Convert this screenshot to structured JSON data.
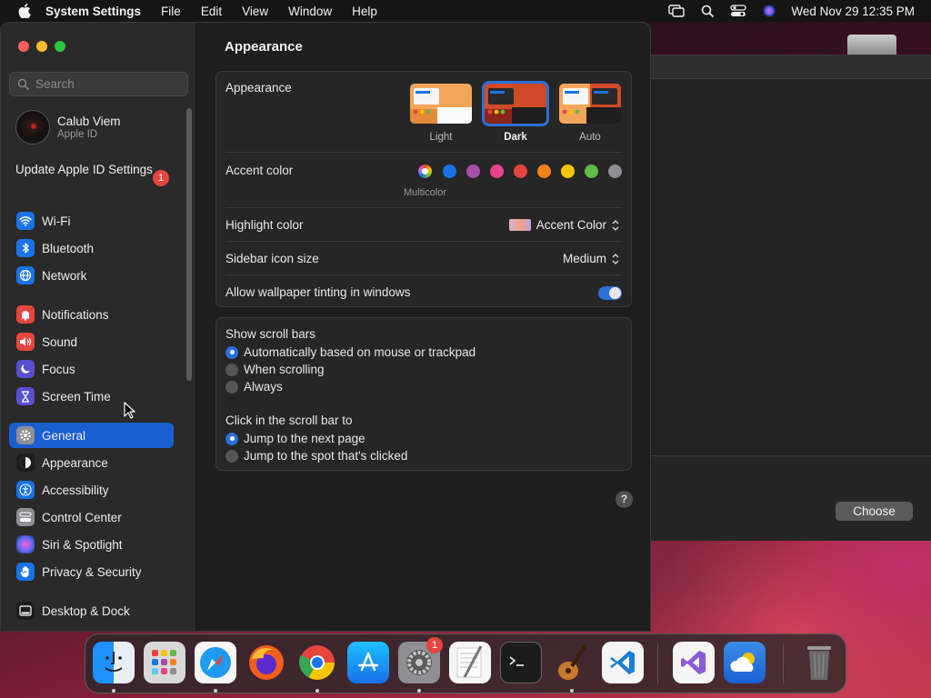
{
  "menubar": {
    "app_name": "System Settings",
    "menus": [
      "File",
      "Edit",
      "View",
      "Window",
      "Help"
    ],
    "clock": "Wed Nov 29  12:35 PM",
    "icons": [
      "screen-mirroring-icon",
      "search-icon",
      "control-center-icon",
      "siri-icon"
    ]
  },
  "window": {
    "search_placeholder": "Search",
    "user": {
      "name": "Calub Viem",
      "subtitle": "Apple ID"
    },
    "update": {
      "label": "Update Apple ID Settings",
      "badge": "1"
    },
    "sidebar": [
      {
        "label": "Wi-Fi",
        "icon": "wifi-icon",
        "color": "#1a73e8"
      },
      {
        "label": "Bluetooth",
        "icon": "bluetooth-icon",
        "color": "#1a73e8"
      },
      {
        "label": "Network",
        "icon": "globe-icon",
        "color": "#1a73e8"
      },
      {
        "label": "Notifications",
        "icon": "bell-icon",
        "color": "#e5453d"
      },
      {
        "label": "Sound",
        "icon": "speaker-icon",
        "color": "#e5453d"
      },
      {
        "label": "Focus",
        "icon": "moon-icon",
        "color": "#5a4fcf"
      },
      {
        "label": "Screen Time",
        "icon": "hourglass-icon",
        "color": "#5a4fcf"
      },
      {
        "label": "General",
        "icon": "gear-icon",
        "color": "#8e8e93"
      },
      {
        "label": "Appearance",
        "icon": "appearance-icon",
        "color": "#1c1c1c"
      },
      {
        "label": "Accessibility",
        "icon": "accessibility-icon",
        "color": "#1a73e8"
      },
      {
        "label": "Control Center",
        "icon": "control-center-icon",
        "color": "#8e8e93"
      },
      {
        "label": "Siri & Spotlight",
        "icon": "siri-icon",
        "color": "#7a3fd0"
      },
      {
        "label": "Privacy & Security",
        "icon": "hand-icon",
        "color": "#1a73e8"
      },
      {
        "label": "Desktop & Dock",
        "icon": "dock-icon",
        "color": "#1c1c1c"
      }
    ],
    "selected_item": "General"
  },
  "content": {
    "title": "Appearance",
    "appearance": {
      "label": "Appearance",
      "options": [
        "Light",
        "Dark",
        "Auto"
      ],
      "selected": "Dark"
    },
    "accent": {
      "label": "Accent color",
      "colors": [
        "#c86bd8",
        "#1a73e8",
        "#a550a7",
        "#e8428c",
        "#e5453d",
        "#f7821b",
        "#f5c600",
        "#62ba46",
        "#8e8e93"
      ],
      "selected_label": "Multicolor"
    },
    "highlight": {
      "label": "Highlight color",
      "value": "Accent Color"
    },
    "icon_size": {
      "label": "Sidebar icon size",
      "value": "Medium"
    },
    "tinting": {
      "label": "Allow wallpaper tinting in windows",
      "on": true
    },
    "scroll_bars": {
      "label": "Show scroll bars",
      "options": [
        "Automatically based on mouse or trackpad",
        "When scrolling",
        "Always"
      ],
      "selected": 0
    },
    "click_scroll": {
      "label": "Click in the scroll bar to",
      "options": [
        "Jump to the next page",
        "Jump to the spot that's clicked"
      ],
      "selected": 0
    },
    "help": "?"
  },
  "bg_window": {
    "button": "Choose"
  },
  "dock": {
    "apps": [
      "Finder",
      "Launchpad",
      "Safari",
      "Firefox",
      "Chrome",
      "App Store",
      "System Settings",
      "TextEdit",
      "Terminal",
      "GarageBand",
      "VS Code",
      "Visual Studio",
      "Weather",
      "Trash"
    ],
    "settings_badge": "1"
  }
}
